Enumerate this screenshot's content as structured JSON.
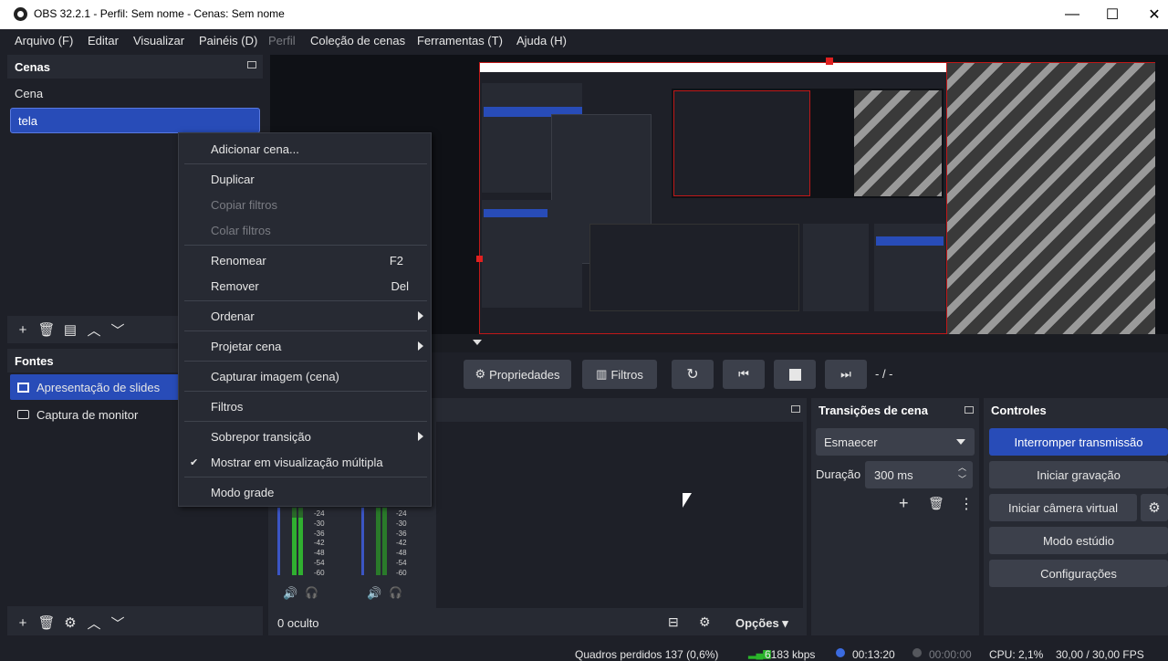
{
  "window": {
    "title": "OBS 32.2.1 - Perfil: Sem nome - Cenas: Sem nome",
    "minimize": "—",
    "maximize": "☐",
    "close": "✕"
  },
  "menu": [
    {
      "label": "Arquivo (F)",
      "disabled": false
    },
    {
      "label": "Editar",
      "disabled": false
    },
    {
      "label": "Visualizar",
      "disabled": false
    },
    {
      "label": "Painéis (D)",
      "disabled": false
    },
    {
      "label": "Perfil",
      "disabled": true
    },
    {
      "label": "Coleção de cenas",
      "disabled": false
    },
    {
      "label": "Ferramentas (T)",
      "disabled": false
    },
    {
      "label": "Ajuda (H)",
      "disabled": false
    }
  ],
  "scenes": {
    "title": "Cenas",
    "items": [
      {
        "label": "Cena",
        "selected": false
      },
      {
        "label": "tela",
        "selected": true
      }
    ]
  },
  "sources": {
    "title": "Fontes",
    "items": [
      {
        "label": "Apresentação de slides",
        "selected": true,
        "icon": "slideshow-icon"
      },
      {
        "label": "Captura de monitor",
        "selected": false,
        "icon": "monitor-icon"
      }
    ]
  },
  "context_menu": {
    "items": [
      {
        "label": "Adicionar cena...",
        "disabled": false
      },
      {
        "label": "Duplicar",
        "disabled": false
      },
      {
        "label": "Copiar filtros",
        "disabled": true
      },
      {
        "label": "Colar filtros",
        "disabled": true
      },
      {
        "label": "Renomear",
        "shortcut": "F2",
        "disabled": false
      },
      {
        "label": "Remover",
        "shortcut": "Del",
        "disabled": false
      },
      {
        "label": "Ordenar",
        "submenu": true,
        "disabled": false
      },
      {
        "label": "Projetar cena",
        "submenu": true,
        "disabled": false
      },
      {
        "label": "Capturar imagem (cena)",
        "disabled": false
      },
      {
        "label": "Filtros",
        "disabled": false
      },
      {
        "label": "Sobrepor transição",
        "submenu": true,
        "disabled": false
      },
      {
        "label": "Mostrar em visualização múltipla",
        "checked": true,
        "disabled": false
      },
      {
        "label": "Modo grade",
        "disabled": false
      }
    ]
  },
  "source_toolbar": {
    "properties": "Propriedades",
    "filters": "Filtros",
    "time": "- / -"
  },
  "mixer": {
    "hidden_count": "0 oculto",
    "options": "Opções",
    "ticks": [
      "-24",
      "-30",
      "-36",
      "-42",
      "-48",
      "-54",
      "-60"
    ]
  },
  "transitions": {
    "title": "Transições de cena",
    "selected": "Esmaecer",
    "duration_label": "Duração",
    "duration_value": "300 ms"
  },
  "controls": {
    "title": "Controles",
    "stop_stream": "Interromper transmissão",
    "start_recording": "Iniciar gravação",
    "start_virtual_cam": "Iniciar câmera virtual",
    "studio_mode": "Modo estúdio",
    "settings": "Configurações"
  },
  "status": {
    "dropped_frames": "Quadros perdidos 137 (0,6%)",
    "bitrate": "6183 kbps",
    "stream_time": "00:13:20",
    "rec_time": "00:00:00",
    "cpu": "CPU: 2,1%",
    "fps": "30,00 / 30,00 FPS"
  },
  "colors": {
    "accent": "#284cb8",
    "background": "#1e2028",
    "dock": "#272a33",
    "meter_green": "#2a9d2a"
  }
}
